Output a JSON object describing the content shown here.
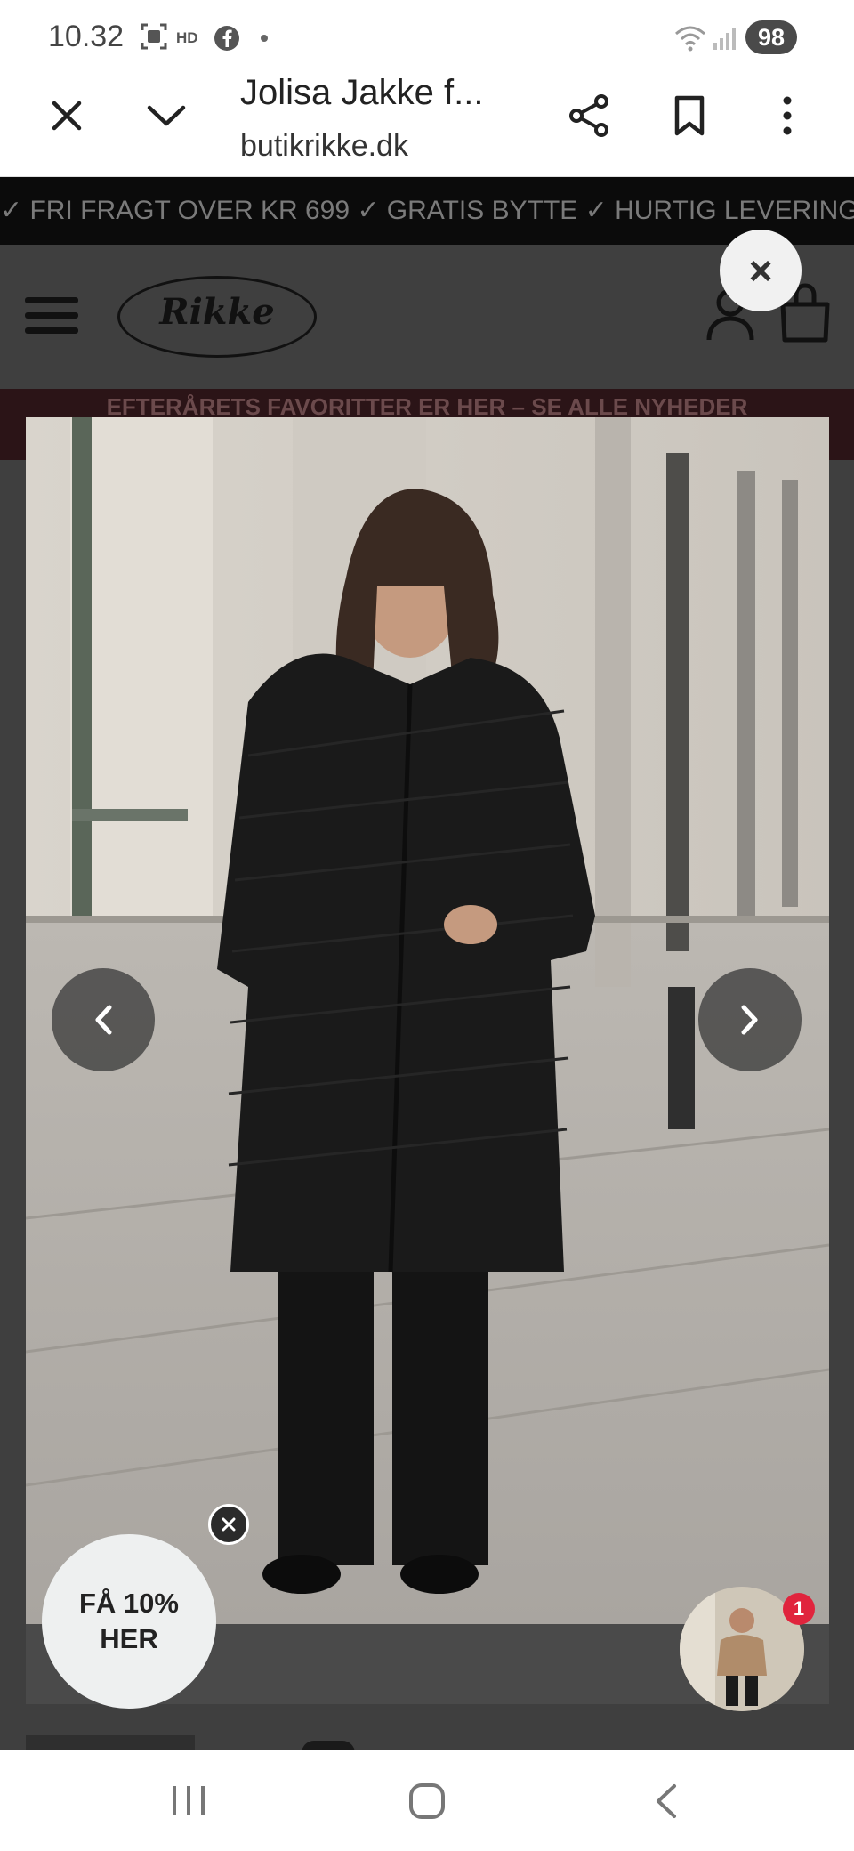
{
  "status_bar": {
    "time": "10.32",
    "battery": "98",
    "icons": [
      "screenshot-icon",
      "hd-icon",
      "facebook-icon",
      "dot-icon",
      "wifi-icon",
      "signal-icon"
    ]
  },
  "browser": {
    "title": "Jolisa Jakke f...",
    "url": "butikrikke.dk",
    "icons": [
      "close-icon",
      "chevron-down-icon",
      "share-icon",
      "bookmark-icon",
      "more-vert-icon"
    ]
  },
  "promo_bar": {
    "text": "✓ FRI FRAGT OVER KR 699 ✓ GRATIS BYTTE ✓ HURTIG LEVERING"
  },
  "site_header": {
    "logo_text": "Rikke",
    "icons": [
      "hamburger-menu-icon",
      "user-icon",
      "shopping-bag-icon"
    ]
  },
  "popup": {
    "close_glyph": "×"
  },
  "banner": {
    "text": "EFTERÅRETS FAVORITTER ER HER – SE ALLE NYHEDER"
  },
  "product": {
    "image_alt": "Woman wearing long black quilted hooded coat",
    "prev_icon": "chevron-left-icon",
    "next_icon": "chevron-right-icon"
  },
  "discount": {
    "line1": "FÅ 10%",
    "line2": "HER"
  },
  "chat": {
    "badge": "1"
  },
  "colors": {
    "overlay": "#3f3f3f",
    "promo_bg": "#0b0b0b",
    "badge": "#e0243d"
  }
}
